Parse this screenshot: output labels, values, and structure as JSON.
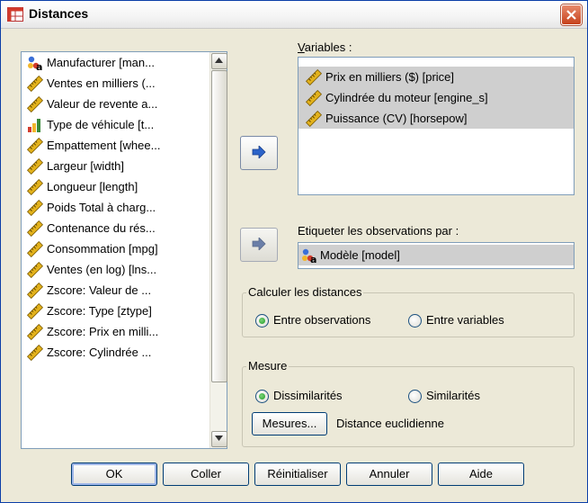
{
  "window": {
    "title": "Distances",
    "colors": {
      "titlebar": "#f4f4f4",
      "body": "#ece9d8",
      "selection": "#cfcfcf",
      "border": "#0b3ea8"
    }
  },
  "source_list": {
    "items": [
      {
        "label": "Manufacturer [man...",
        "icon": "nominal-string-icon"
      },
      {
        "label": "Ventes en milliers (...",
        "icon": "scale-ruler-icon"
      },
      {
        "label": "Valeur de revente a...",
        "icon": "scale-ruler-icon"
      },
      {
        "label": "Type de véhicule [t...",
        "icon": "ordinal-bars-icon"
      },
      {
        "label": "Empattement [whee...",
        "icon": "scale-ruler-icon"
      },
      {
        "label": "Largeur [width]",
        "icon": "scale-ruler-icon"
      },
      {
        "label": "Longueur [length]",
        "icon": "scale-ruler-icon"
      },
      {
        "label": "Poids Total à charg...",
        "icon": "scale-ruler-icon"
      },
      {
        "label": "Contenance du rés...",
        "icon": "scale-ruler-icon"
      },
      {
        "label": "Consommation [mpg]",
        "icon": "scale-ruler-icon"
      },
      {
        "label": "Ventes (en log) [lns...",
        "icon": "scale-ruler-icon"
      },
      {
        "label": "Zscore:  Valeur de ...",
        "icon": "scale-ruler-icon"
      },
      {
        "label": "Zscore:  Type [ztype]",
        "icon": "scale-ruler-icon"
      },
      {
        "label": "Zscore:  Prix en milli...",
        "icon": "scale-ruler-icon"
      },
      {
        "label": "Zscore:  Cylindrée ...",
        "icon": "scale-ruler-icon"
      }
    ]
  },
  "variables": {
    "label": "Variables :",
    "items": [
      {
        "label": "Prix en milliers ($) [price]",
        "icon": "scale-ruler-icon"
      },
      {
        "label": "Cylindrée du moteur [engine_s]",
        "icon": "scale-ruler-icon"
      },
      {
        "label": "Puissance (CV) [horsepow]",
        "icon": "scale-ruler-icon"
      }
    ]
  },
  "label_cases": {
    "label": "Etiqueter les observations par :",
    "item": {
      "label": "Modèle [model]",
      "icon": "nominal-string-icon"
    }
  },
  "compute": {
    "title": "Calculer les distances",
    "options": [
      {
        "label": "Entre observations",
        "selected": true
      },
      {
        "label": "Entre variables",
        "selected": false
      }
    ]
  },
  "measure": {
    "title": "Mesure",
    "options": [
      {
        "label": "Dissimilarités",
        "selected": true
      },
      {
        "label": "Similarités",
        "selected": false
      }
    ],
    "button": "Mesures...",
    "current": "Distance euclidienne"
  },
  "buttons": {
    "ok": "OK",
    "paste": "Coller",
    "reset": "Réinitialiser",
    "cancel": "Annuler",
    "help": "Aide"
  }
}
